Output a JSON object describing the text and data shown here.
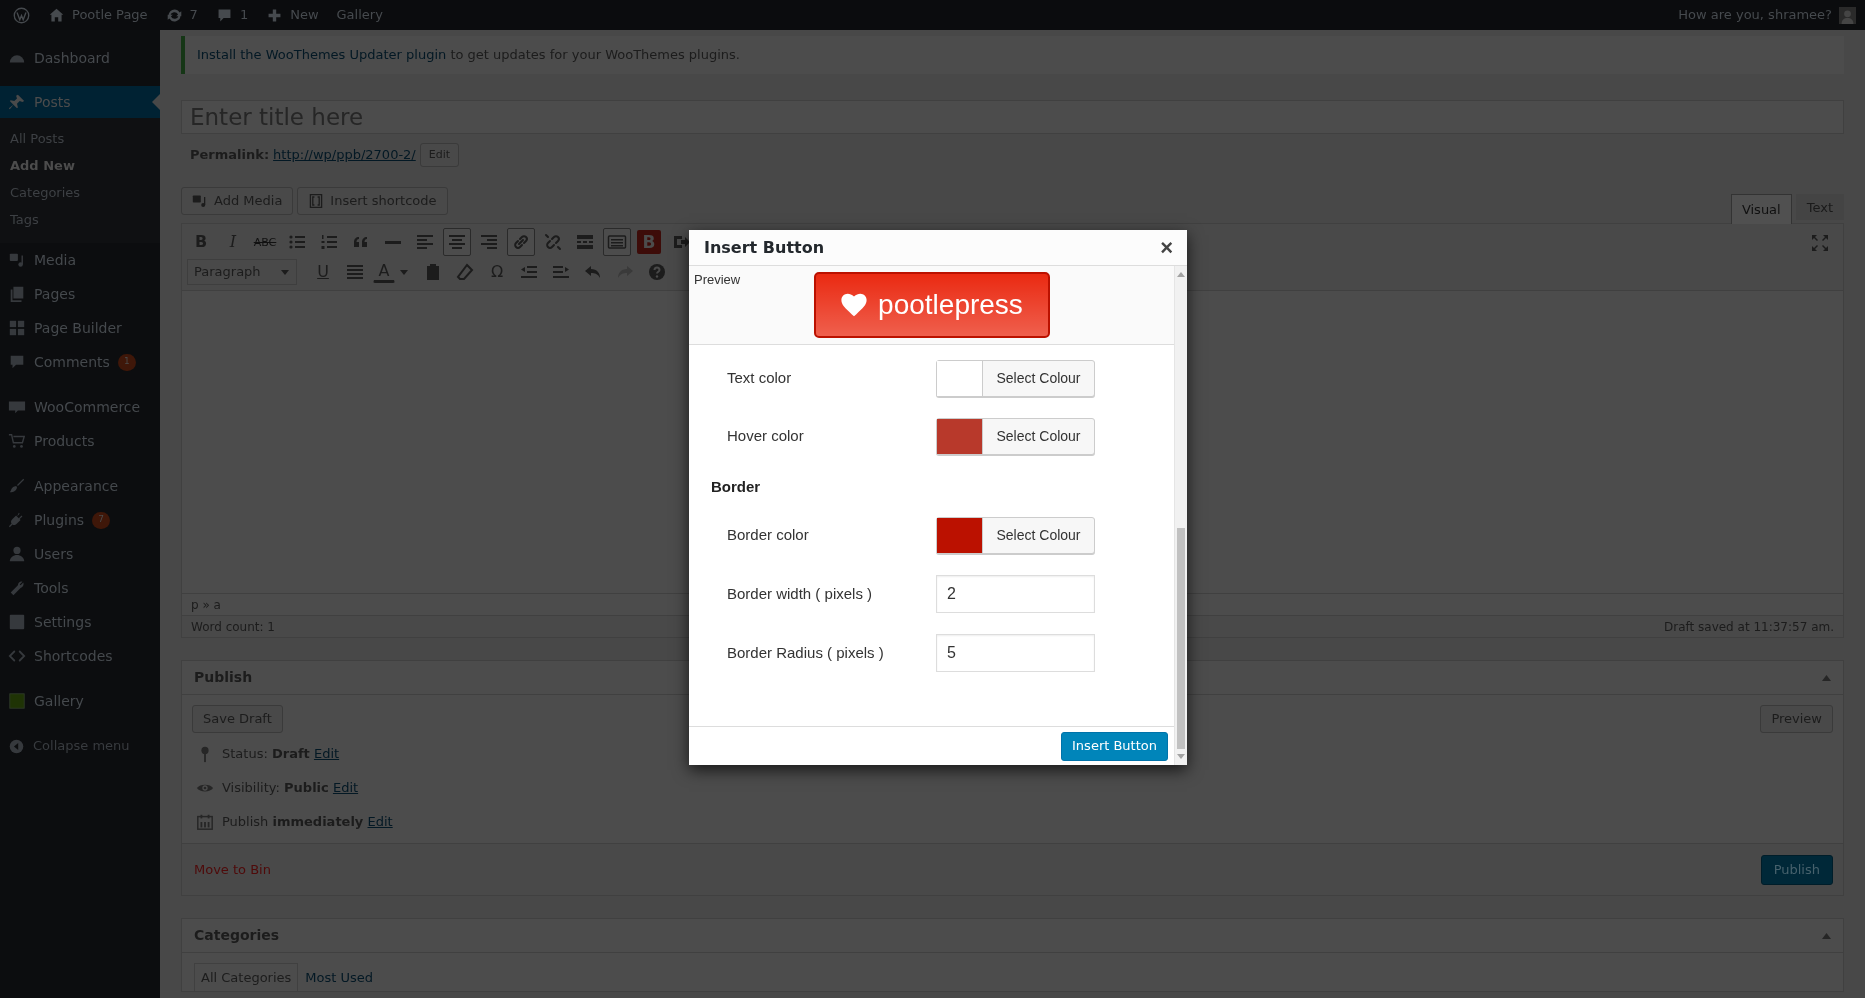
{
  "admin_bar": {
    "site": "Pootle Page",
    "updates": "7",
    "comments": "1",
    "new": "New",
    "gallery": "Gallery",
    "greeting": "How are you, shramee?"
  },
  "sidebar": {
    "groups": [
      [
        {
          "label": "Dashboard",
          "selected": false
        }
      ],
      [
        {
          "label": "Posts",
          "selected": true,
          "children": [
            {
              "label": "All Posts",
              "selected": false
            },
            {
              "label": "Add New",
              "selected": true
            },
            {
              "label": "Categories",
              "selected": false
            },
            {
              "label": "Tags",
              "selected": false
            }
          ]
        },
        {
          "label": "Media",
          "selected": false
        },
        {
          "label": "Pages",
          "selected": false
        },
        {
          "label": "Page Builder",
          "selected": false
        },
        {
          "label": "Comments",
          "selected": false,
          "badge": "1"
        }
      ],
      [
        {
          "label": "WooCommerce",
          "selected": false
        },
        {
          "label": "Products",
          "selected": false
        }
      ],
      [
        {
          "label": "Appearance",
          "selected": false
        },
        {
          "label": "Plugins",
          "selected": false,
          "badge": "7"
        },
        {
          "label": "Users",
          "selected": false
        },
        {
          "label": "Tools",
          "selected": false
        },
        {
          "label": "Settings",
          "selected": false
        },
        {
          "label": "Shortcodes",
          "selected": false
        }
      ],
      [
        {
          "label": "Gallery",
          "selected": false
        }
      ]
    ],
    "collapse": "Collapse menu"
  },
  "notice": {
    "link": "Install the WooThemes Updater plugin",
    "text": " to get updates for your WooThemes plugins."
  },
  "title_field": {
    "placeholder": "Enter title here"
  },
  "permalink": {
    "label": "Permalink:",
    "url": "http://wp/ppb/2700-2/",
    "edit": "Edit"
  },
  "media_buttons": [
    "Add Media",
    "Insert shortcode"
  ],
  "editor_tabs": [
    {
      "label": "Visual",
      "selected": true
    },
    {
      "label": "Text",
      "selected": false
    }
  ],
  "toolbar": {
    "top_row": [
      {
        "label": "B",
        "pressed": false
      },
      {
        "label": "I",
        "pressed": false
      },
      {
        "label": "ABC",
        "pressed": false
      },
      {
        "pressed": false
      },
      {
        "pressed": false
      },
      {
        "pressed": false
      },
      {
        "pressed": false
      },
      {
        "pressed": false
      },
      {
        "pressed": true
      },
      {
        "pressed": false
      },
      {
        "pressed": true
      },
      {
        "pressed": false
      },
      {
        "pressed": false
      },
      {
        "pressed": true
      },
      {
        "label": "B",
        "pressed": false
      },
      {
        "pressed": false
      }
    ],
    "bottom_row": [
      {
        "kind": "select",
        "label": "Paragraph"
      },
      {
        "kind": "button",
        "label": "U",
        "disabled": false
      },
      {
        "kind": "button",
        "disabled": false
      },
      {
        "kind": "button",
        "label": "A",
        "disabled": false
      },
      {
        "kind": "button",
        "disabled": false
      },
      {
        "kind": "button",
        "disabled": false
      },
      {
        "kind": "button",
        "label": "Ω",
        "disabled": false
      },
      {
        "kind": "button",
        "disabled": false
      },
      {
        "kind": "button",
        "disabled": false
      },
      {
        "kind": "button",
        "disabled": false
      },
      {
        "kind": "button",
        "disabled": true
      },
      {
        "kind": "button",
        "disabled": false
      }
    ]
  },
  "status_path": "p » a",
  "word_count": "Word count: 1",
  "autosave": "Draft saved at 11:37:57 am.",
  "publish": {
    "title": "Publish",
    "save_draft": "Save Draft",
    "preview": "Preview",
    "meta": [
      {
        "text": "Status: **Draft**",
        "edit": "Edit"
      },
      {
        "text": "Visibility: **Public**",
        "edit": "Edit"
      },
      {
        "text": "Publish **immediately**",
        "edit": "Edit"
      }
    ],
    "trash": "Move to Bin",
    "submit": "Publish"
  },
  "categories": {
    "title": "Categories",
    "tabs": [
      {
        "label": "All Categories",
        "selected": true
      },
      {
        "label": "Most Used",
        "selected": false
      }
    ]
  },
  "modal": {
    "title": "Insert Button",
    "close": "×",
    "preview_label": "Preview",
    "preview_button": {
      "label": "pootlepress",
      "color": "#ea2a12"
    },
    "fields": [
      {
        "kind": "color",
        "label": "Text color",
        "color": "#ffffff",
        "button": "Select Colour"
      },
      {
        "kind": "color",
        "label": "Hover color",
        "color": "#b8392b",
        "button": "Select Colour"
      },
      {
        "kind": "heading",
        "label": "Border"
      },
      {
        "kind": "color",
        "label": "Border color",
        "color": "#bb1100",
        "button": "Select Colour"
      },
      {
        "kind": "number",
        "label": "Border width ( pixels )",
        "value": "2"
      },
      {
        "kind": "number",
        "label": "Border Radius ( pixels )",
        "value": "5"
      }
    ],
    "submit": "Insert Button"
  }
}
